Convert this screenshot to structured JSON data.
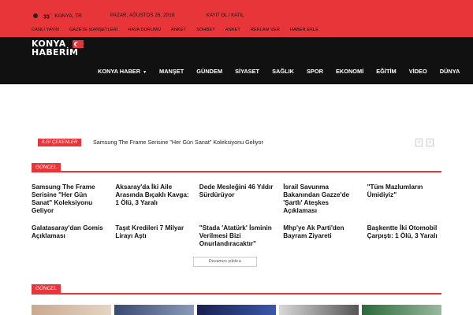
{
  "topbar": {
    "temperature": "33",
    "temp_unit": "°",
    "city": "KONYA, TR",
    "date": "PAZAR, AĞUSTOS 26, 2018",
    "login": "KAYIT OL / KATIL",
    "menu": [
      "CANLI YAYIN",
      "GAZETE MANŞETLERİ",
      "HAVA DURUMU",
      "ANKET",
      "SOHBET",
      "ANKET",
      "REKLAM VER",
      "HABER EKLE"
    ]
  },
  "logo": {
    "line1": "KONYA",
    "line2": "HABERİM"
  },
  "nav": {
    "items": [
      "KONYA HABER",
      "MANŞET",
      "GÜNDEM",
      "SİYASET",
      "SAĞLIK",
      "SPOR",
      "EKONOMİ",
      "EĞİTİM",
      "VİDEO",
      "DÜNYA"
    ]
  },
  "ticker": {
    "label": "İLGİ ÇEKENLER",
    "text": "Samsung The Frame Serisine \"Her Gün Sanat\" Koleksiyonu Geliyor",
    "prev": "‹",
    "next": "›"
  },
  "section1": {
    "title": "GÜNCEL"
  },
  "articles": [
    "Samsung The Frame Serisine \"Her Gün Sanat\" Koleksiyonu Geliyor",
    "Aksaray'da İki Aile Arasında Bıçaklı Kavga: 1 Ölü, 3 Yaralı",
    "Dede Mesleğini 46 Yıldır Sürdürüyor",
    "İsrail Savunma Bakanından Gazze'de 'Şartlı' Ateşkes Açıklaması",
    "\"Tüm Mazlumların Ümidiyiz\"",
    "Galatasaray'dan Gomis Açıklaması",
    "Taşıt Kredileri 7 Milyar Lirayı Aştı",
    "\"Stada 'Atatürk' İsminin Verilmesi Bizi Onurlandıracaktır\"",
    "Mhp'ye Ak Parti'den Bayram Ziyareti",
    "Başkentte İki Otomobil Çarpıştı: 1 Ölü, 3 Yaralı"
  ],
  "more_button": "Devamını yükle",
  "section2": {
    "title": "GÜNCEL"
  },
  "colors": {
    "brand_red": "#e8353a",
    "header_black": "#111111"
  }
}
